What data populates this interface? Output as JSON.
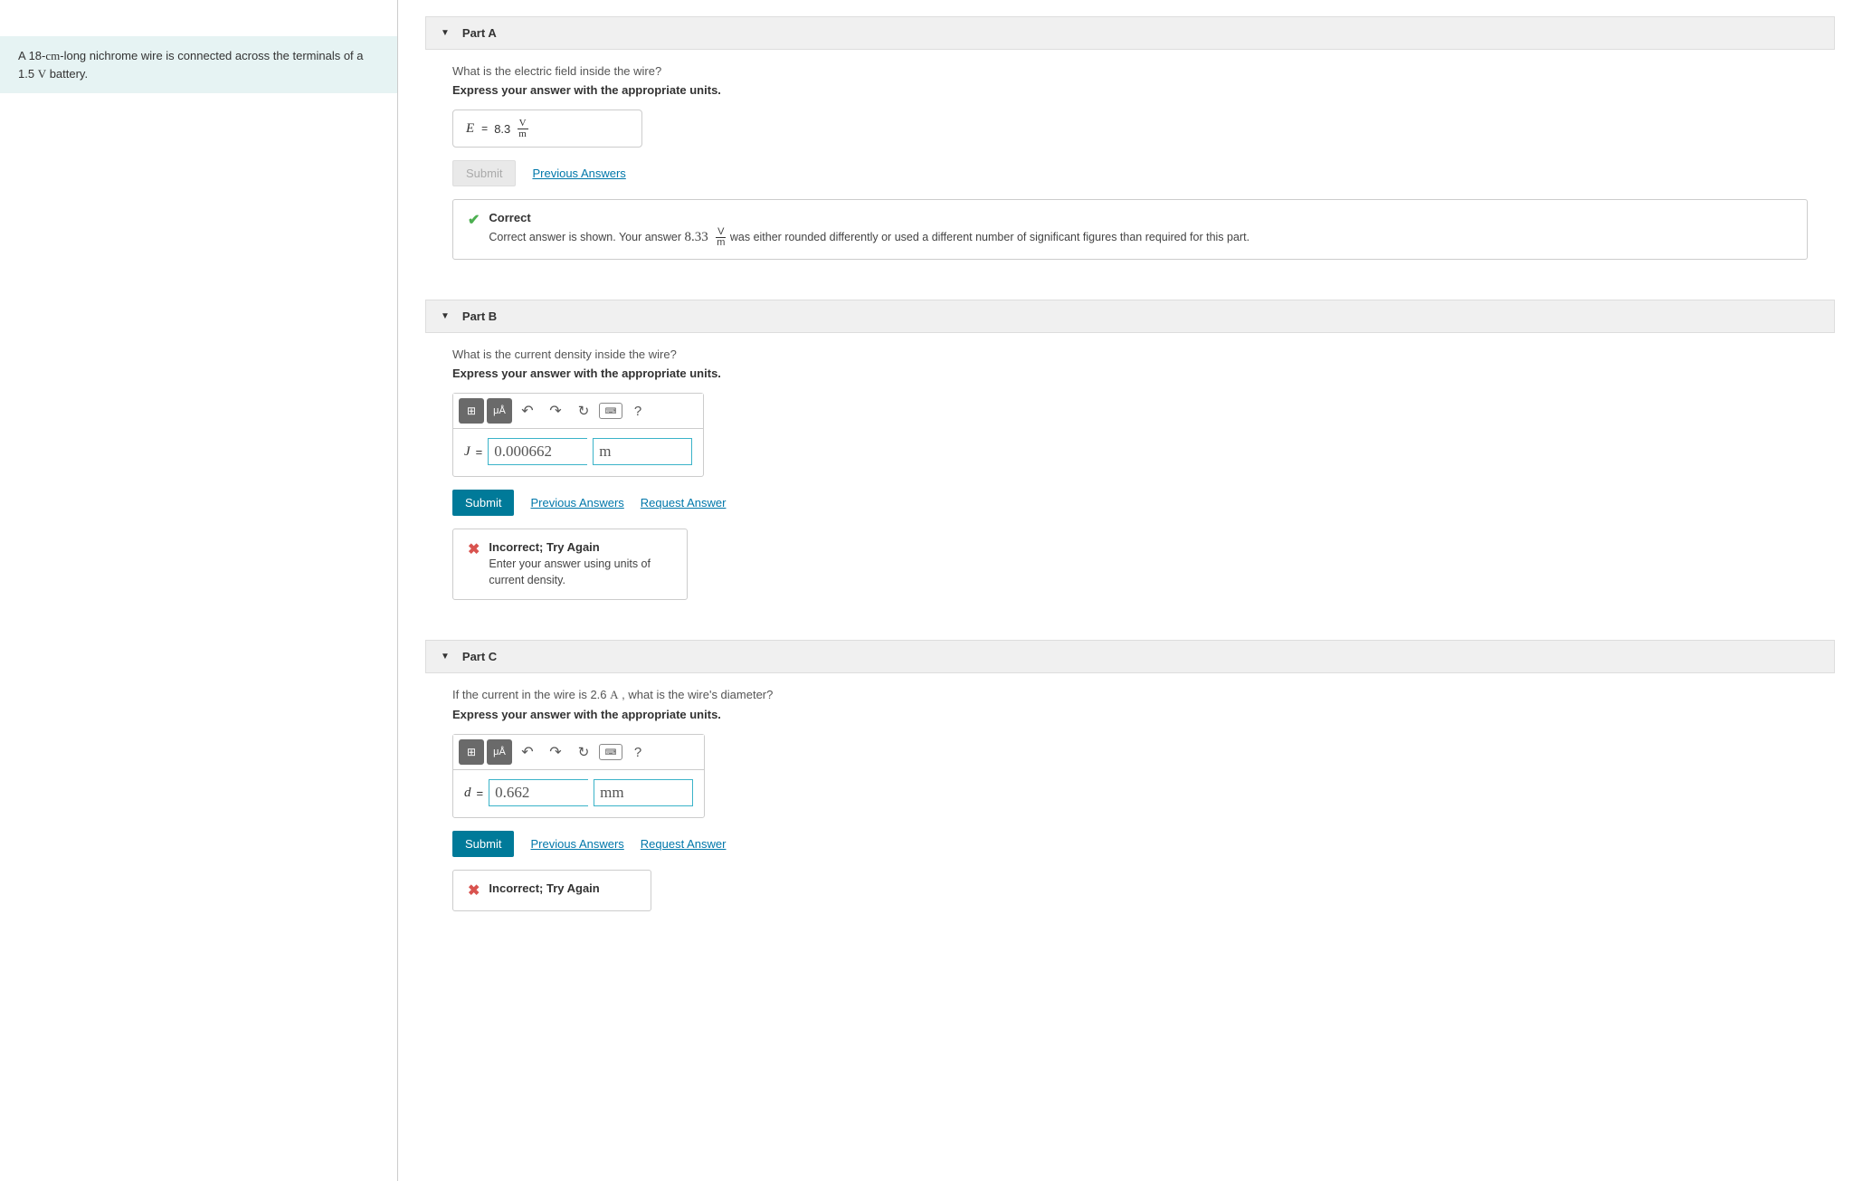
{
  "problem": {
    "prefix": "A 18-",
    "unit1": "cm",
    "mid": "-long nichrome wire is connected across the terminals of a 1.5 ",
    "unit2": "V",
    "suffix": " battery."
  },
  "partA": {
    "title": "Part A",
    "question": "What is the electric field inside the wire?",
    "instruction": "Express your answer with the appropriate units.",
    "var": "E",
    "value": "8.3",
    "unit_num": "V",
    "unit_den": "m",
    "submit": "Submit",
    "prev": "Previous Answers",
    "feedback_title": "Correct",
    "feedback_pre": "Correct answer is shown. Your answer ",
    "feedback_val": "8.33",
    "feedback_unit_num": "V",
    "feedback_unit_den": "m",
    "feedback_post": " was either rounded differently or used a different number of significant figures than required for this part."
  },
  "partB": {
    "title": "Part B",
    "question": "What is the current density inside the wire?",
    "instruction": "Express your answer with the appropriate units.",
    "var": "J",
    "value": "0.000662",
    "unit": "m",
    "submit": "Submit",
    "prev": "Previous Answers",
    "req": "Request Answer",
    "feedback_title": "Incorrect; Try Again",
    "feedback_text": "Enter your answer using units of current density."
  },
  "partC": {
    "title": "Part C",
    "q_pre": "If the current in the wire is 2.6 ",
    "q_unit": "A",
    "q_post": " , what is the wire's diameter?",
    "instruction": "Express your answer with the appropriate units.",
    "var": "d",
    "value": "0.662",
    "unit": "mm",
    "submit": "Submit",
    "prev": "Previous Answers",
    "req": "Request Answer",
    "feedback_title": "Incorrect; Try Again"
  },
  "toolbar": {
    "templates": "⊞",
    "symbols": "μÅ",
    "undo": "↶",
    "redo": "↷",
    "reset": "↻",
    "keyboard": "⌨",
    "help": "?"
  }
}
